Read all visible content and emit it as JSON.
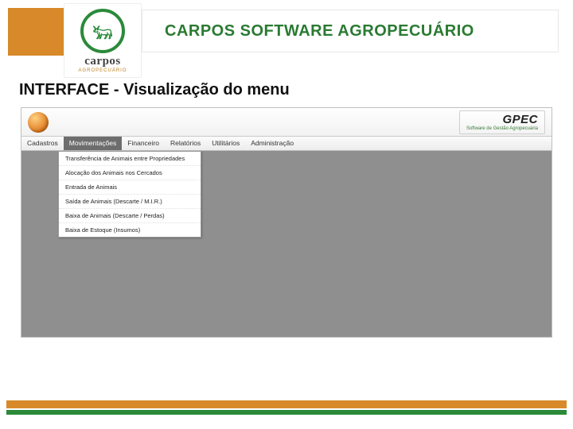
{
  "brand": {
    "name": "carpos",
    "subline": "AGROPECUÁRIO",
    "header_title": "CARPOS SOFTWARE AGROPECUÁRIO"
  },
  "section_title": "INTERFACE - Visualização do menu",
  "app": {
    "product_name": "GPEC",
    "product_tagline": "Software de Gestão Agropecuária"
  },
  "menubar": [
    "Cadastros",
    "Movimentações",
    "Financeiro",
    "Relatórios",
    "Utilitários",
    "Administração"
  ],
  "active_menu_index": 1,
  "dropdown": [
    "Transferência de Animais entre Propriedades",
    "Alocação dos Animais nos Cercados",
    "Entrada de Animais",
    "Saída de Animais (Descarte / M.I.R.)",
    "Baixa de Animais (Descarte / Perdas)",
    "Baixa de Estoque (Insumos)"
  ]
}
